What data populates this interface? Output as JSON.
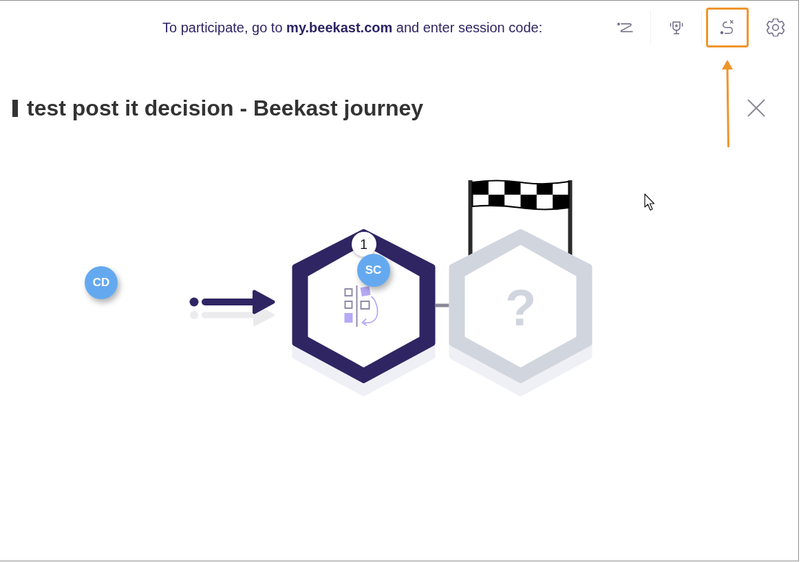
{
  "header": {
    "instruction": "To participate, go to **my.beekast.com** and enter session code:"
  },
  "toolbar": [
    {
      "highlighted": false
    },
    {
      "highlighted": false
    },
    {
      "highlighted": true
    },
    {
      "highlighted": false
    }
  ],
  "title": "test post it decision - Beekast journey",
  "journey": {
    "start_participants": [
      "CD"
    ],
    "steps": [
      {
        "kind": "activity",
        "active": true,
        "number": "1",
        "participants": [
          "SC"
        ]
      },
      {
        "kind": "finish",
        "active": false,
        "label": "?"
      }
    ]
  }
}
